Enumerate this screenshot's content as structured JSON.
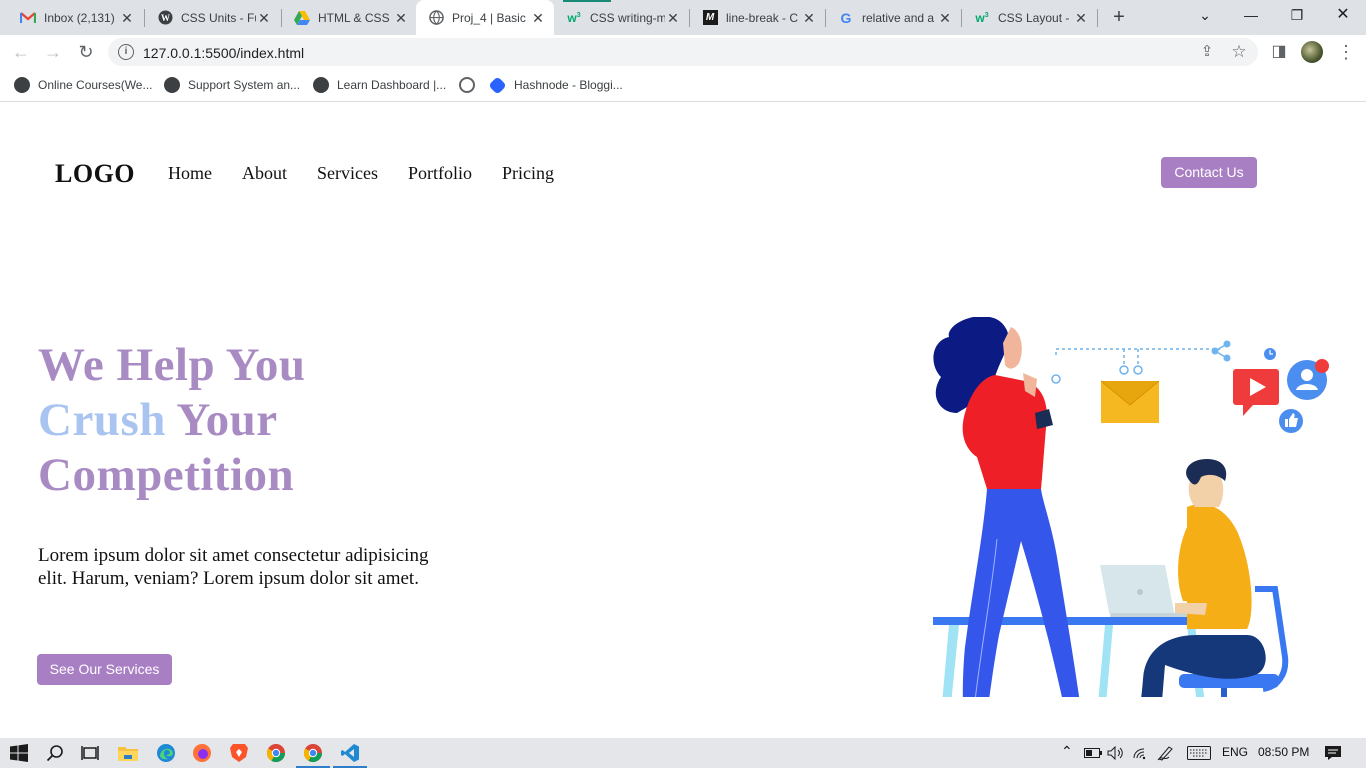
{
  "browser": {
    "tabs": [
      {
        "title": "Inbox (2,131)",
        "icon": "gmail-icon"
      },
      {
        "title": "CSS Units - Fu",
        "icon": "wordpress-icon"
      },
      {
        "title": "HTML & CSS",
        "icon": "google-drive-icon"
      },
      {
        "title": "Proj_4 | Basic",
        "icon": "globe-icon",
        "active": true
      },
      {
        "title": "CSS writing-m",
        "icon": "w3schools-icon"
      },
      {
        "title": "line-break - C",
        "icon": "mdn-icon"
      },
      {
        "title": "relative and a",
        "icon": "google-icon"
      },
      {
        "title": "CSS Layout - ",
        "icon": "w3schools-icon"
      }
    ],
    "close_glyph": "✕",
    "new_tab_glyph": "+",
    "window": {
      "chevron": "⌄",
      "minimize": "—",
      "maximize": "❐",
      "close": "✕"
    },
    "address": {
      "url": "127.0.0.1:5500/index.html",
      "info_glyph": "i"
    },
    "nav": {
      "back": "←",
      "forward": "→",
      "reload": "↻"
    },
    "toolbar_icons": {
      "share": "⇪",
      "star": "☆",
      "sidepanel": "◨",
      "menu": "⋮"
    },
    "bookmarks": [
      {
        "label": "Online Courses(We...",
        "icon": "wordpress-icon"
      },
      {
        "label": "Support System an...",
        "icon": "wordpress-icon"
      },
      {
        "label": "Learn Dashboard |...",
        "icon": "wordpress-icon"
      },
      {
        "label": "",
        "icon": "globe-icon"
      },
      {
        "label": "Hashnode - Bloggi...",
        "icon": "hashnode-icon"
      }
    ]
  },
  "site": {
    "logo": "LOGO",
    "nav": [
      "Home",
      "About",
      "Services",
      "Portfolio",
      "Pricing"
    ],
    "contact_button": "Contact Us",
    "hero": {
      "line1": "We Help You",
      "line2_highlight": "Crush",
      "line2_rest": "Your",
      "line3": "Competition",
      "text": "Lorem ipsum dolor sit amet consectetur adipisicing elit. Harum, veniam? Lorem ipsum dolor sit amet.",
      "button": "See Our Services"
    },
    "colors": {
      "accent": "#a97fc4",
      "heading": "#a98bc3",
      "highlight": "#a9c4f0"
    }
  },
  "taskbar": {
    "apps": [
      "windows-start-icon",
      "search-icon",
      "task-view-icon",
      "file-explorer-icon",
      "edge-icon",
      "firefox-icon",
      "brave-icon",
      "chrome-icon",
      "chrome-icon",
      "vscode-icon"
    ],
    "tray": {
      "language": "ENG",
      "time": "08:50 PM",
      "chevron": "⌃"
    }
  }
}
